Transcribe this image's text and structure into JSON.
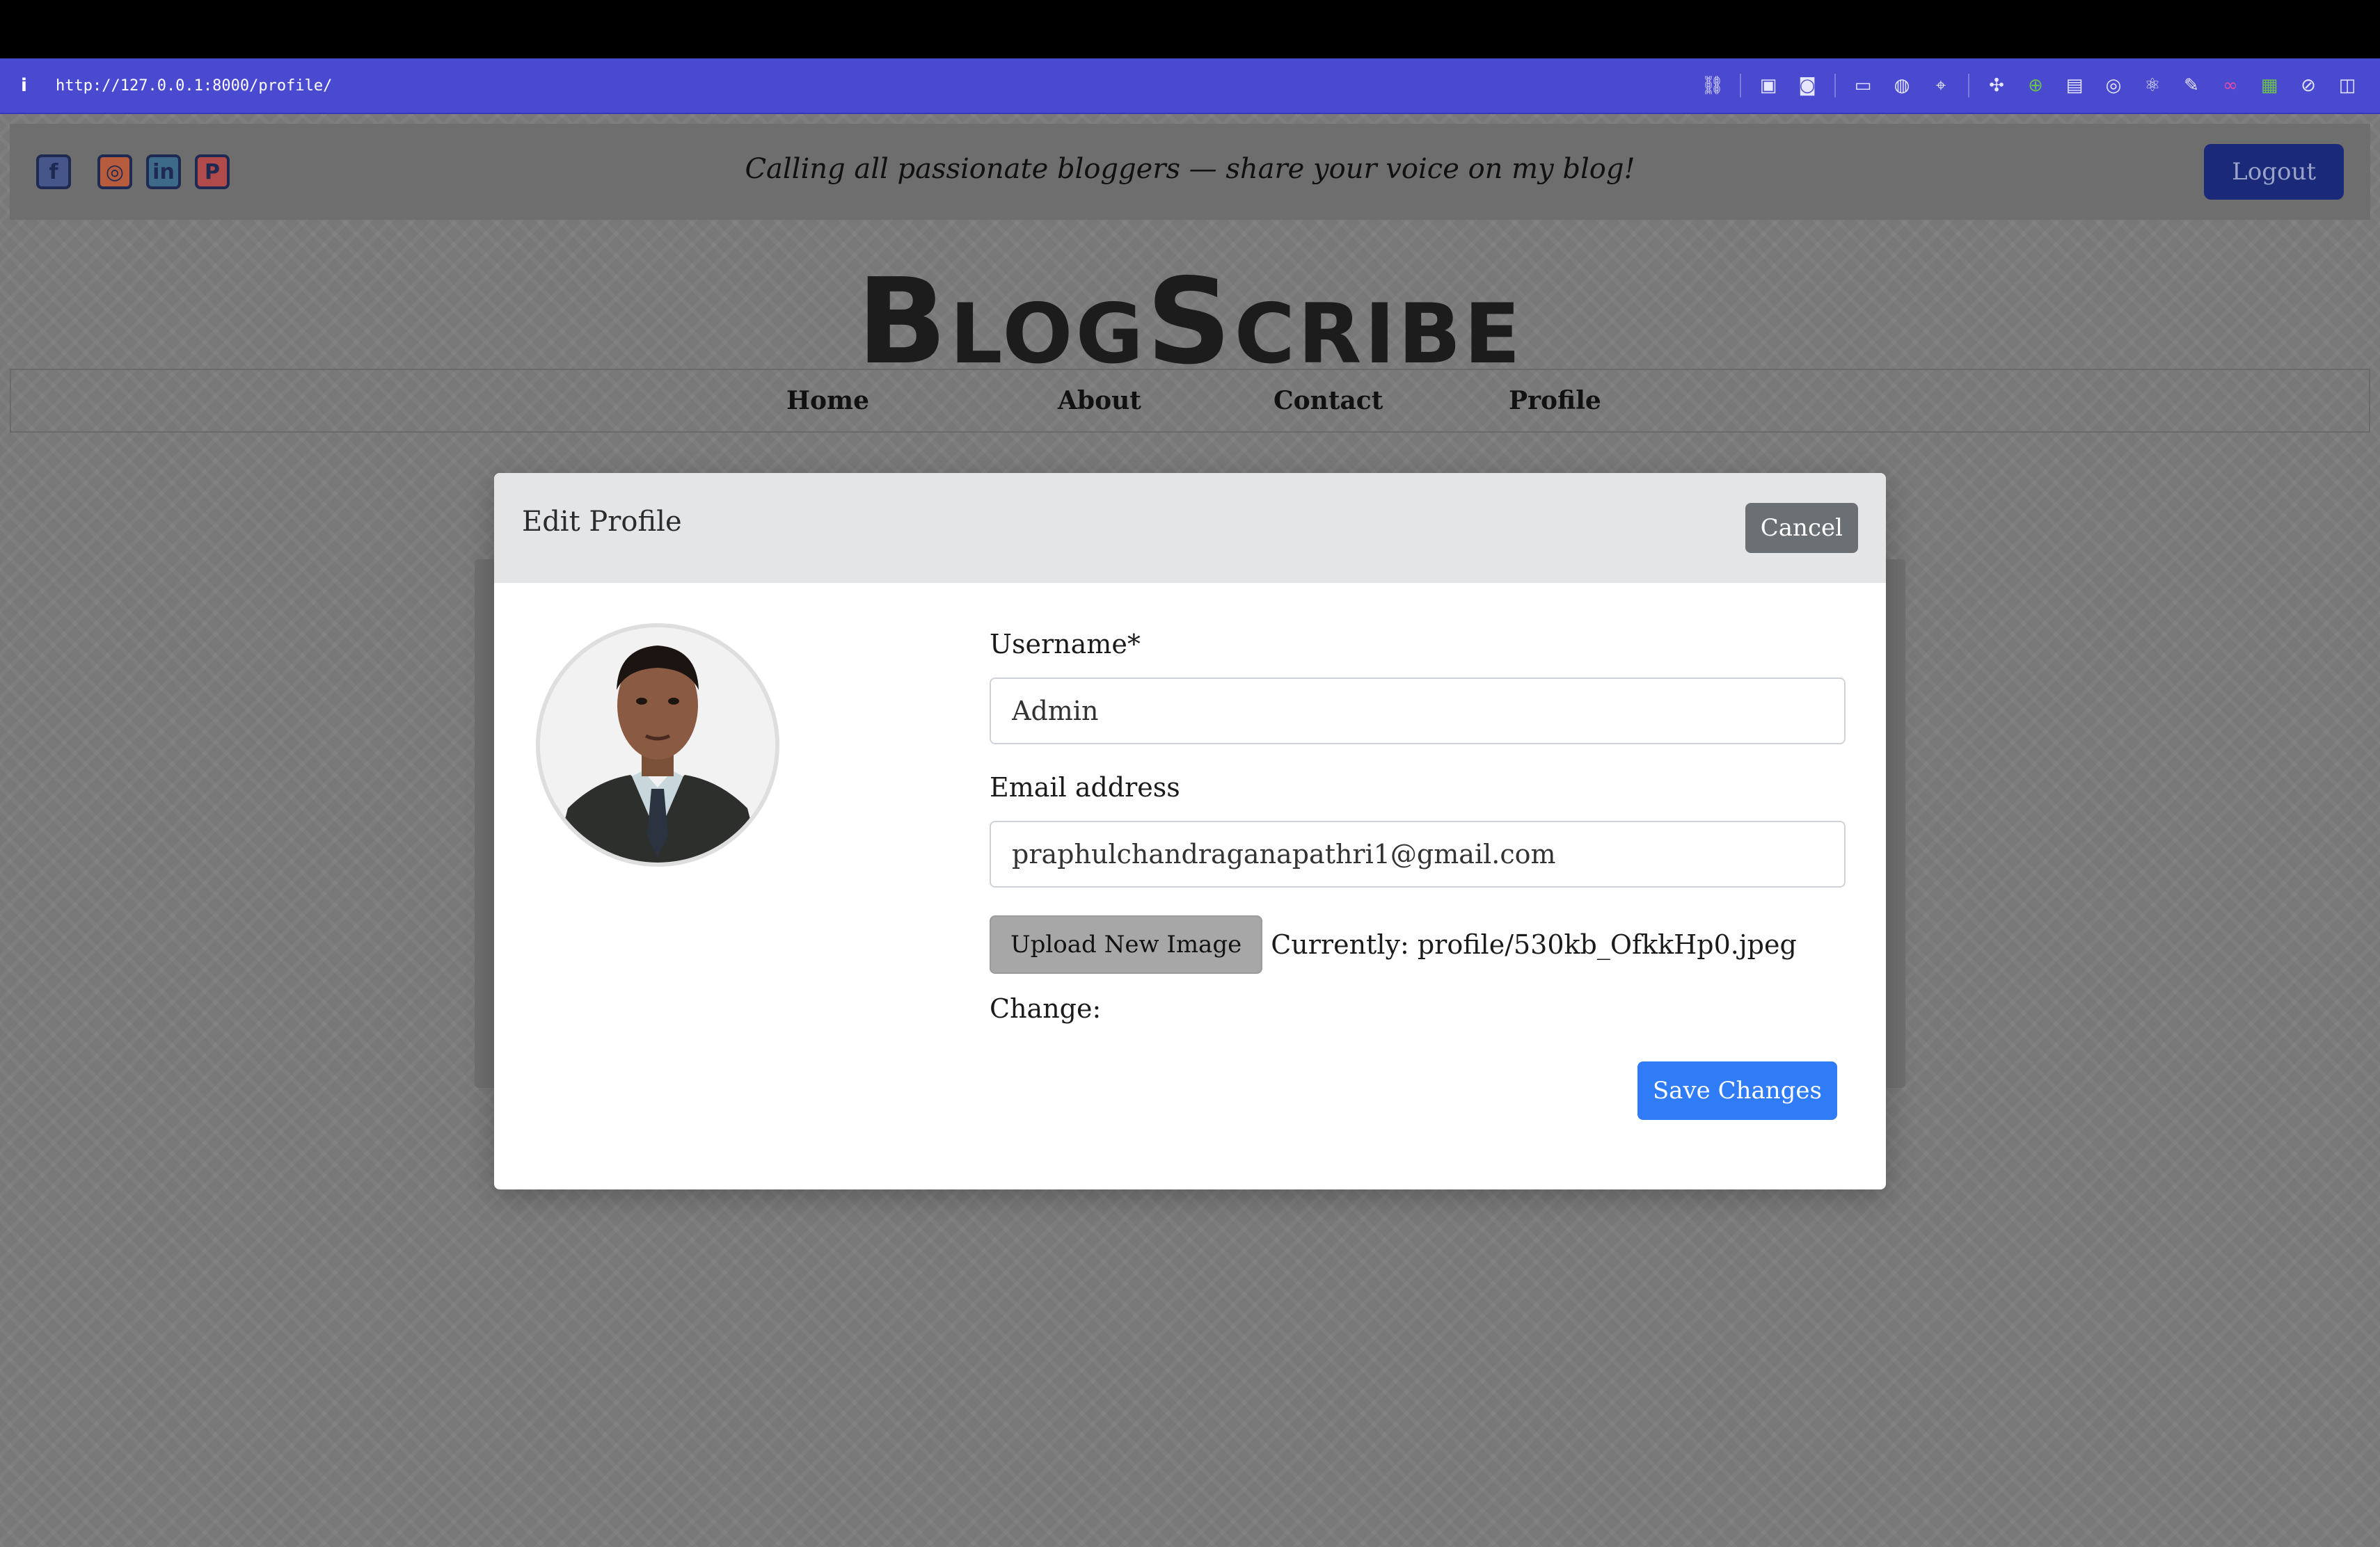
{
  "browser": {
    "url": "http://127.0.0.1:8000/profile/",
    "info_icon": "i"
  },
  "header": {
    "tagline": "Calling all passionate bloggers — share your voice on my blog!",
    "logout_label": "Logout",
    "social_icons": [
      "facebook-icon",
      "instagram-icon",
      "linkedin-icon",
      "pinterest-icon"
    ]
  },
  "brand": {
    "name": "BlogScribe"
  },
  "nav": {
    "items": [
      {
        "label": "Home"
      },
      {
        "label": "About"
      },
      {
        "label": "Contact"
      },
      {
        "label": "Profile"
      }
    ]
  },
  "modal": {
    "title": "Edit Profile",
    "cancel_label": "Cancel",
    "username_label": "Username*",
    "username_value": "Admin",
    "email_label": "Email address",
    "email_value": "praphulchandraganapathri1@gmail.com",
    "upload_label": "Upload New Image",
    "currently_text": "Currently: profile/530kb_OfkkHp0.jpeg",
    "change_label": "Change:",
    "save_label": "Save Changes"
  },
  "colors": {
    "browser_bar": "#4a4ad0",
    "logout_bg": "#1a2a78",
    "save_bg": "#2f7cf6",
    "cancel_bg": "#6b7075"
  }
}
